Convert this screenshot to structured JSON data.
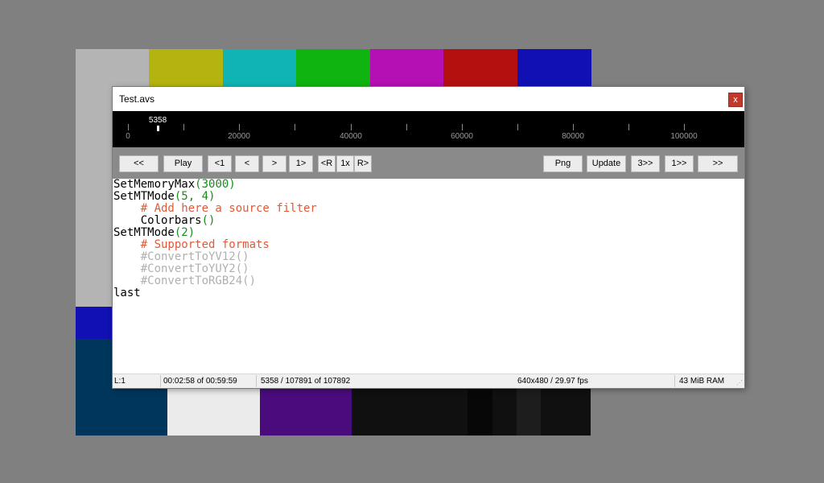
{
  "colors": {
    "top_bars": [
      "#b4b4b4",
      "#b4b410",
      "#10b4b4",
      "#10b410",
      "#b410b4",
      "#b41010",
      "#1010b4"
    ],
    "mid_left": "#1010b4",
    "bottom": [
      "#00365c",
      "#ebebeb",
      "#4a0c7c",
      "#101010",
      "#101010",
      "#070707",
      "#101010",
      "#1d1d1d",
      "#101010"
    ]
  },
  "window": {
    "title": "Test.avs",
    "close_label": "x"
  },
  "timeline": {
    "max": 107891,
    "current": 5358,
    "current_label": "5358",
    "labels": [
      "0",
      "20000",
      "40000",
      "60000",
      "80000",
      "100000"
    ]
  },
  "toolbar": {
    "first": "<<",
    "play": "Play",
    "back1": "<1",
    "prev": "<",
    "next": ">",
    "fwd1": "1>",
    "range_start": "<R",
    "speed": "1x",
    "range_end": "R>",
    "png": "Png",
    "update": "Update",
    "fwd3": "3>>",
    "fwd1b": "1>>",
    "last": ">>"
  },
  "editor": {
    "l1_fn": "SetMemoryMax",
    "l1_args": "(3000)",
    "l2_fn": "SetMTMode",
    "l2_args": "(5, 4)",
    "l3_comment": "    # Add here a source filter",
    "l4_fn": "    Colorbars",
    "l4_args": "()",
    "l5_fn": "SetMTMode",
    "l5_args": "(2)",
    "l6_comment": "    # Supported formats",
    "l7": "    #ConvertToYV12()",
    "l8": "    #ConvertToYUY2()",
    "l9": "    #ConvertToRGB24()",
    "l10": "last"
  },
  "status": {
    "line": "L:1",
    "time": "00:02:58 of 00:59:59",
    "frames": "5358 / 107891 of 107892",
    "resolution": "640x480 / 29.97 fps",
    "memory": "43 MiB RAM"
  }
}
